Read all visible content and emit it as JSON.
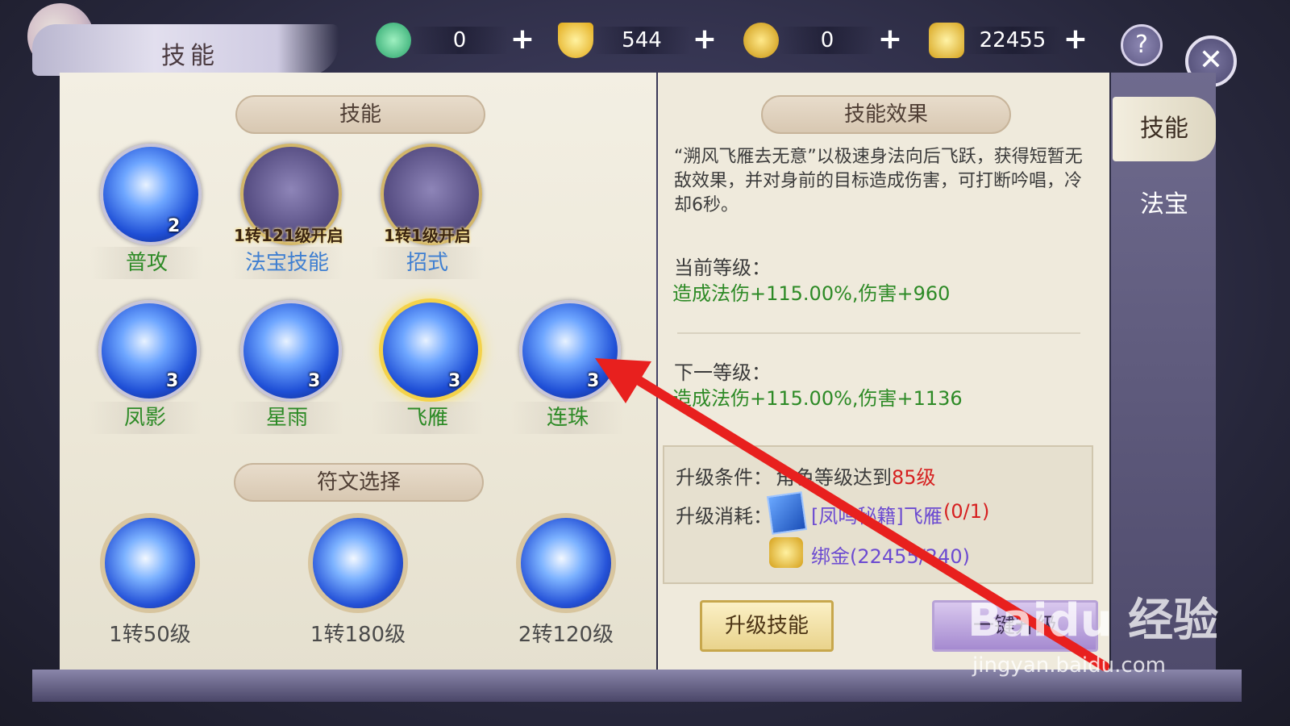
{
  "header": {
    "title": "技能",
    "resources": [
      {
        "icon": "jade-icon",
        "value": "0"
      },
      {
        "icon": "gold-ingot-icon",
        "value": "544"
      },
      {
        "icon": "coin-icon",
        "value": "0"
      },
      {
        "icon": "bound-gold-icon",
        "value": "22455"
      }
    ],
    "help_label": "?",
    "close_label": "✕"
  },
  "skills": {
    "banner": "技能",
    "items": [
      {
        "name": "普攻",
        "level": "2",
        "lock": ""
      },
      {
        "name": "法宝技能",
        "level": "",
        "lock": "1转121级开启"
      },
      {
        "name": "招式",
        "level": "",
        "lock": "1转1级开启"
      },
      {
        "name": "凤影",
        "level": "3",
        "lock": ""
      },
      {
        "name": "星雨",
        "level": "3",
        "lock": ""
      },
      {
        "name": "飞雁",
        "level": "3",
        "lock": ""
      },
      {
        "name": "连珠",
        "level": "3",
        "lock": ""
      }
    ]
  },
  "runes": {
    "banner": "符文选择",
    "items": [
      {
        "label": "1转50级"
      },
      {
        "label": "1转180级"
      },
      {
        "label": "2转120级"
      }
    ]
  },
  "effect": {
    "banner": "技能效果",
    "description": "“溯风飞雁去无意”以极速身法向后飞跃，获得短暂无敌效果，并对身前的目标造成伤害，可打断吟唱，冷却6秒。",
    "current_label": "当前等级：",
    "current_value": "造成法伤+115.00%,伤害+960",
    "next_label": "下一等级：",
    "next_value": "造成法伤+115.00%,伤害+1136",
    "condition_label": "升级条件：",
    "condition_text": "角色等级达到",
    "condition_level": "85级",
    "cost_label": "升级消耗：",
    "cost_item_name": "[凤鸣秘籍]飞雁",
    "cost_item_count": "(0/1)",
    "cost_gold": "绑金(22455/240)",
    "upgrade_button": "升级技能",
    "onekey_button": "一键升级"
  },
  "side_tabs": [
    "技能",
    "法宝"
  ],
  "watermark": {
    "brand": "Baidu 经验",
    "url": "jingyan.baidu.com"
  },
  "colors": {
    "accent_green": "#2d8a26",
    "accent_blue": "#3f7fd1",
    "cost_purple": "#6c4bd1",
    "highlight_red": "#d62020"
  }
}
